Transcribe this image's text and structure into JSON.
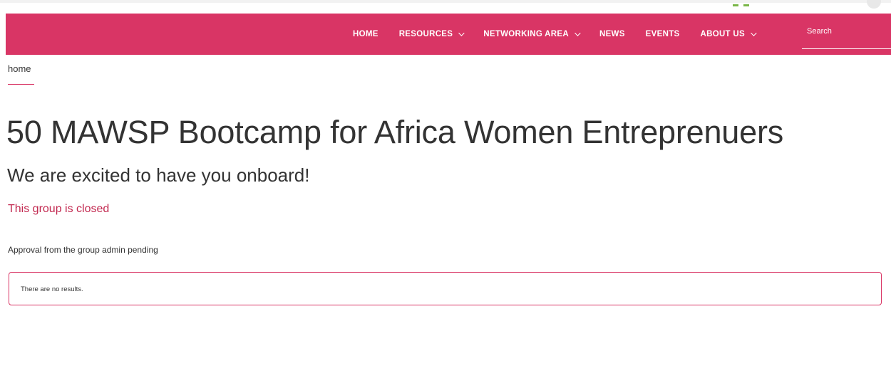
{
  "nav": {
    "items": [
      {
        "label": "HOME",
        "has_dropdown": false
      },
      {
        "label": "RESOURCES",
        "has_dropdown": true
      },
      {
        "label": "NETWORKING AREA",
        "has_dropdown": true
      },
      {
        "label": "NEWS",
        "has_dropdown": false
      },
      {
        "label": "EVENTS",
        "has_dropdown": false
      },
      {
        "label": "ABOUT US",
        "has_dropdown": true
      }
    ],
    "search_placeholder": "Search",
    "background_color": "#d93565"
  },
  "breadcrumb": {
    "label": "home"
  },
  "group": {
    "title": "50 MAWSP Bootcamp for Africa Women Entreprenuers",
    "subtitle": "We are excited to have you onboard!",
    "status": "This group is closed",
    "approval_message": "Approval from the group admin pending",
    "results_message": "There are no results."
  },
  "colors": {
    "accent": "#d93565",
    "status_text": "#c2284f",
    "body_text": "#333333"
  }
}
